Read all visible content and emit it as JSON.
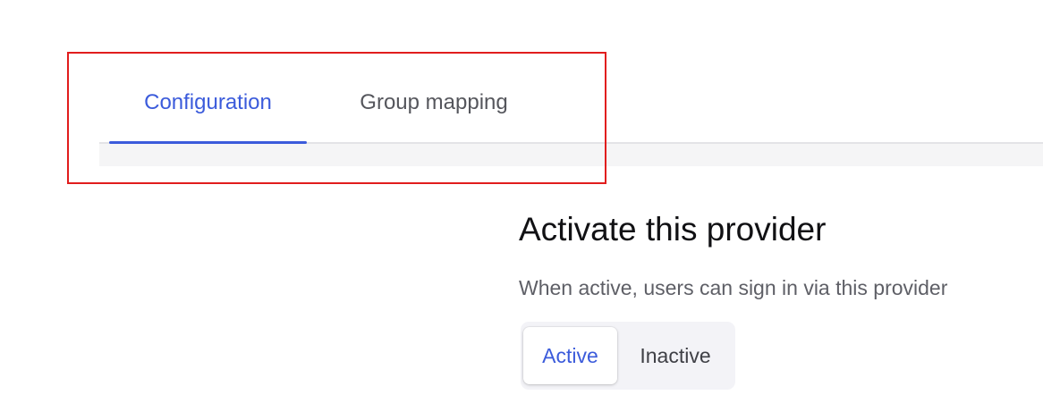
{
  "tabs": {
    "items": [
      {
        "label": "Configuration",
        "selected": true
      },
      {
        "label": "Group mapping",
        "selected": false
      }
    ]
  },
  "activation": {
    "title": "Activate this provider",
    "description": "When active, users can sign in via this provider",
    "options": [
      {
        "label": "Active",
        "selected": true
      },
      {
        "label": "Inactive",
        "selected": false
      }
    ]
  },
  "colors": {
    "accent": "#3b5bdb",
    "highlight_border": "#e11d1d",
    "text_primary": "#111114",
    "text_secondary": "#5e5f66"
  }
}
